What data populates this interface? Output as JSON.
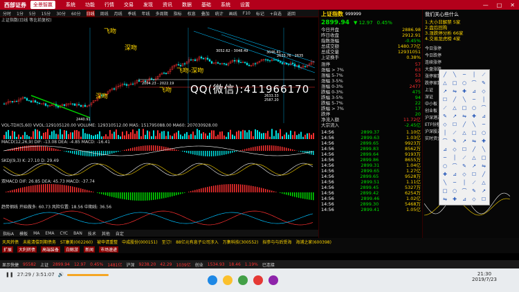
{
  "app": {
    "brand": "西部证券",
    "brand2": "全景智赢",
    "menus": [
      "系统",
      "功能",
      "行情",
      "交易",
      "发现",
      "资讯",
      "数据",
      "基础",
      "系统",
      "设置"
    ],
    "window_controls": [
      "—",
      "□",
      "✕"
    ]
  },
  "toolbar": {
    "items": [
      "分时",
      "1分",
      "5分",
      "15分",
      "30分",
      "60分",
      "日线",
      "周线",
      "月线",
      "季线",
      "年线",
      "多周期",
      "指标",
      "权息",
      "叠加",
      "统计",
      "画线",
      "F10",
      "标记",
      "+自选",
      "返回"
    ]
  },
  "chart": {
    "title": "上证指数(日线 等比前复权)",
    "annotations": [
      "深吻",
      "深吻",
      "飞吻",
      "飞吻-深吻",
      "飞吻"
    ],
    "price_labels": [
      "3052.62 - 3048.49",
      "3046.41",
      "2633.76 - 2635",
      "2004.23 - 2022.19",
      "2440.91",
      "2633.33",
      "2587.20"
    ],
    "watermark": "QQ(微信):411966170"
  },
  "indicators": [
    {
      "label": "VOL-TDX(5,60) VVOL:129105120.00 VOLUME: 129310512.00 MA5: 151795088.00 MA60: 207030928.00"
    },
    {
      "label": "MACD(12,26,9) DIF: -13.08 DEA: -4.85 MACD: -16.41"
    },
    {
      "label": "SKDJ(9,3) K: 27.10 D: 29.49"
    },
    {
      "label": "双MACD DIF: 26.85 DEA: 45.73 MACD: -37.74"
    },
    {
      "label": "趋势钢线 开始做多: 60.73 风险位置: 18.56 中期线: 36.56"
    }
  ],
  "bottom_tabs": [
    "指标A",
    "模板",
    "MA",
    "EMA",
    "CYC",
    "BAN",
    "技术",
    "其他",
    "自定"
  ],
  "quote": {
    "name": "上证指数",
    "code": "999999",
    "price": "2899.94",
    "change": "▼ 12.97",
    "pct": "0.45%",
    "rows": [
      [
        "今日开盘",
        "2886.98"
      ],
      [
        "昨日收盘",
        "2912.91"
      ],
      [
        "指数涨幅",
        "-0.45%"
      ],
      [
        "总成交额",
        "1480.77亿"
      ],
      [
        "总成交量",
        "12931051"
      ],
      [
        "上证换手",
        "0.38%"
      ]
    ],
    "dist": [
      [
        "涨停",
        "57"
      ],
      [
        "涨幅 > 7%",
        "63"
      ],
      [
        "涨幅 5-7%",
        "53"
      ],
      [
        "涨幅 3-5%",
        "95"
      ],
      [
        "涨幅 0-3%",
        "2477"
      ],
      [
        "跌幅 0-3%",
        "475"
      ],
      [
        "跌幅 3-5%",
        "94"
      ],
      [
        "跌幅 5-7%",
        "22"
      ],
      [
        "跌幅 > 7%",
        "17"
      ],
      [
        "跌停",
        "20"
      ]
    ],
    "flows": [
      [
        "净流入额",
        "11.72亿"
      ],
      [
        "大宗流入",
        "-2.45亿"
      ]
    ],
    "ticks": [
      [
        "14:56",
        "2899.37",
        "1.10亿"
      ],
      [
        "14:56",
        "2899.63",
        "1.03亿"
      ],
      [
        "14:56",
        "2899.65",
        "9923万"
      ],
      [
        "14:56",
        "2899.83",
        "8562万"
      ],
      [
        "14:56",
        "2899.64",
        "9193万"
      ],
      [
        "14:56",
        "2899.86",
        "8655万"
      ],
      [
        "14:56",
        "2899.31",
        "1.04亿"
      ],
      [
        "14:56",
        "2899.65",
        "1.27亿"
      ],
      [
        "14:56",
        "2899.65",
        "9528万"
      ],
      [
        "14:56",
        "2899.51",
        "1.11亿"
      ],
      [
        "14:56",
        "2899.45",
        "5327万"
      ],
      [
        "14:56",
        "2899.42",
        "6254万"
      ],
      [
        "14:56",
        "2899.46",
        "1.02亿"
      ],
      [
        "14:56",
        "2899.30",
        "5468万"
      ],
      [
        "14:56",
        "2899.41",
        "1.05亿"
      ]
    ]
  },
  "far": {
    "title": "我们关心些什么",
    "items": [
      "1.大小非解禁 5家",
      "2.盘后回购",
      "3.涨跌停分析 66家",
      "4.交易龙虎榜 4家"
    ],
    "labels": [
      "今日涨停",
      "今日跌停",
      "连续涨停",
      "大盘涨跌",
      "涨停家数",
      "跌停家数",
      "上证",
      "深证",
      "中小板",
      "创业板",
      "沪深港通",
      "ETF份额",
      "沪深股通",
      "实时资金流入"
    ]
  },
  "ticker": {
    "line1": [
      "天风转债",
      "未能清偿到期债务",
      "ST康美(002260)",
      "被申请重整",
      "中成股份(000151)",
      "至订!",
      "88亿元有息子公司涉入",
      "万集科技(300552)",
      "拟参与与后受海",
      "海浦之家(600398)"
    ],
    "line2": [
      "扩展",
      "大利转债",
      "高端装备",
      "白鲸游",
      "新闻",
      "市场速递"
    ]
  },
  "status": {
    "items": [
      "显示快捷",
      "95582",
      "上证",
      "2899.94",
      "12.97",
      "0.45%",
      "1481亿",
      "沪深",
      "9238.20",
      "42.29",
      "1039亿",
      "创业",
      "1534.93",
      "18.46",
      "1.19%",
      "已连接"
    ]
  },
  "taskbar": {
    "time": "21:30",
    "date": "2019/7/23",
    "elapsed": "27:29 / 3:51:07"
  }
}
